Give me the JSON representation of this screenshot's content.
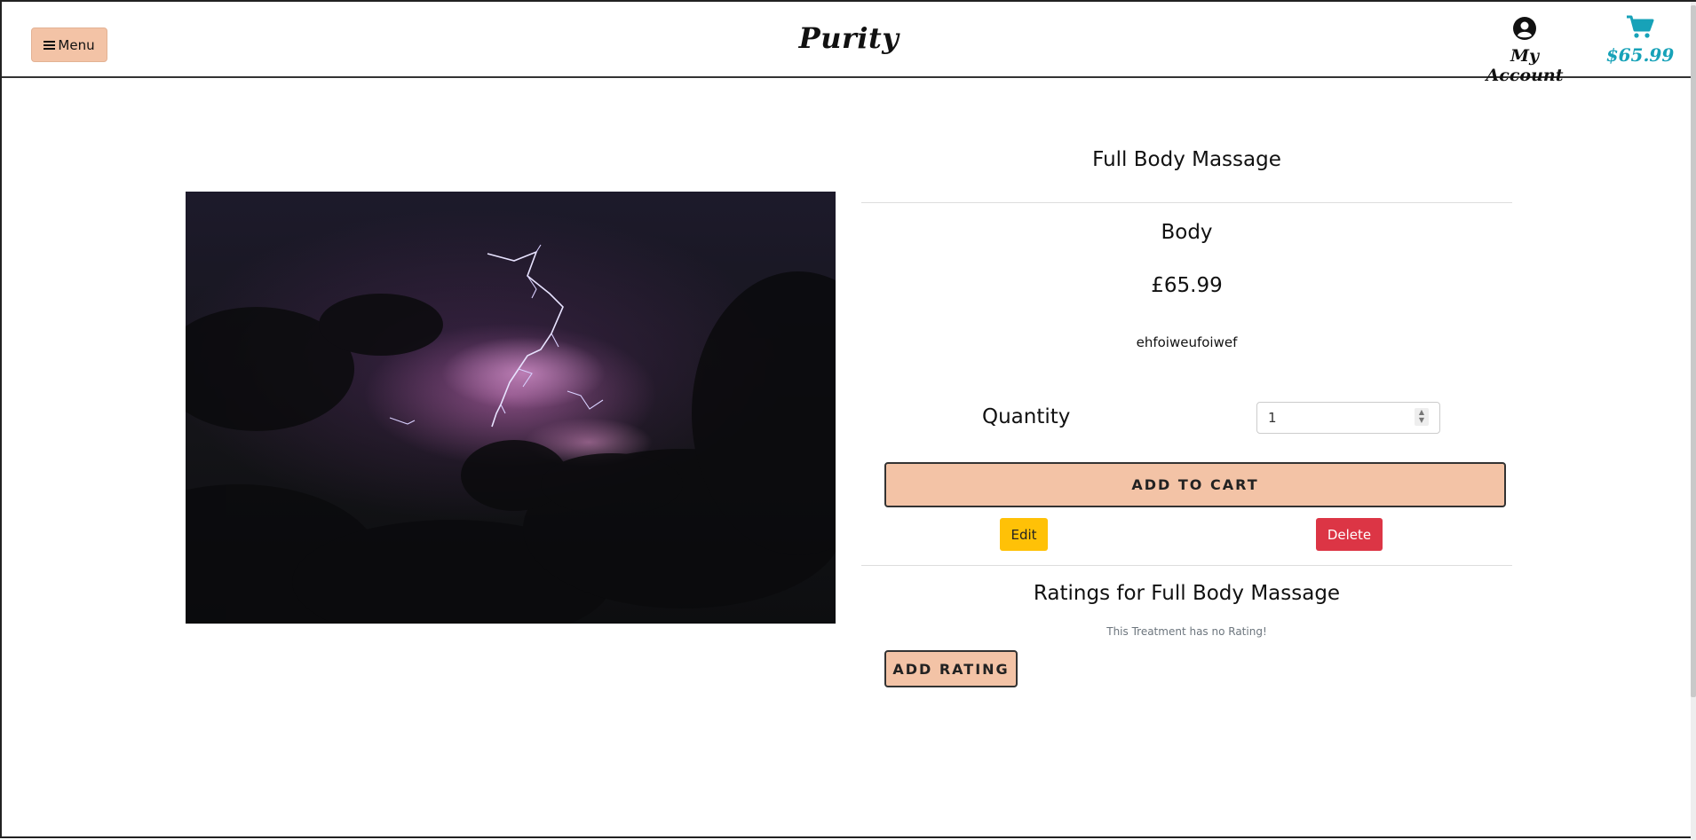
{
  "navbar": {
    "menu_label": "Menu",
    "brand": "Purity",
    "account_label": "My Account",
    "cart_total": "$65.99",
    "icons": {
      "menu": "hamburger-icon",
      "account": "user-circle-icon",
      "cart": "shopping-cart-icon"
    },
    "colors": {
      "menu_button": "#f3c3a6",
      "cart": "#17a2b8"
    }
  },
  "product": {
    "name": "Full Body Massage",
    "category": "Body",
    "price": "£65.99",
    "description": "ehfoiweufoiwef",
    "image_alt": "storm-clouds-lightning-image"
  },
  "quantity": {
    "label": "Quantity",
    "value": "1"
  },
  "actions": {
    "add_to_cart": "ADD TO CART",
    "edit": "Edit",
    "delete": "Delete",
    "colors": {
      "add_to_cart": "#f3c3a6",
      "edit": "#ffc107",
      "delete": "#dc3545"
    }
  },
  "ratings": {
    "title": "Ratings for Full Body Massage",
    "empty_message": "This Treatment has no Rating!",
    "add_rating": "ADD RATING"
  }
}
